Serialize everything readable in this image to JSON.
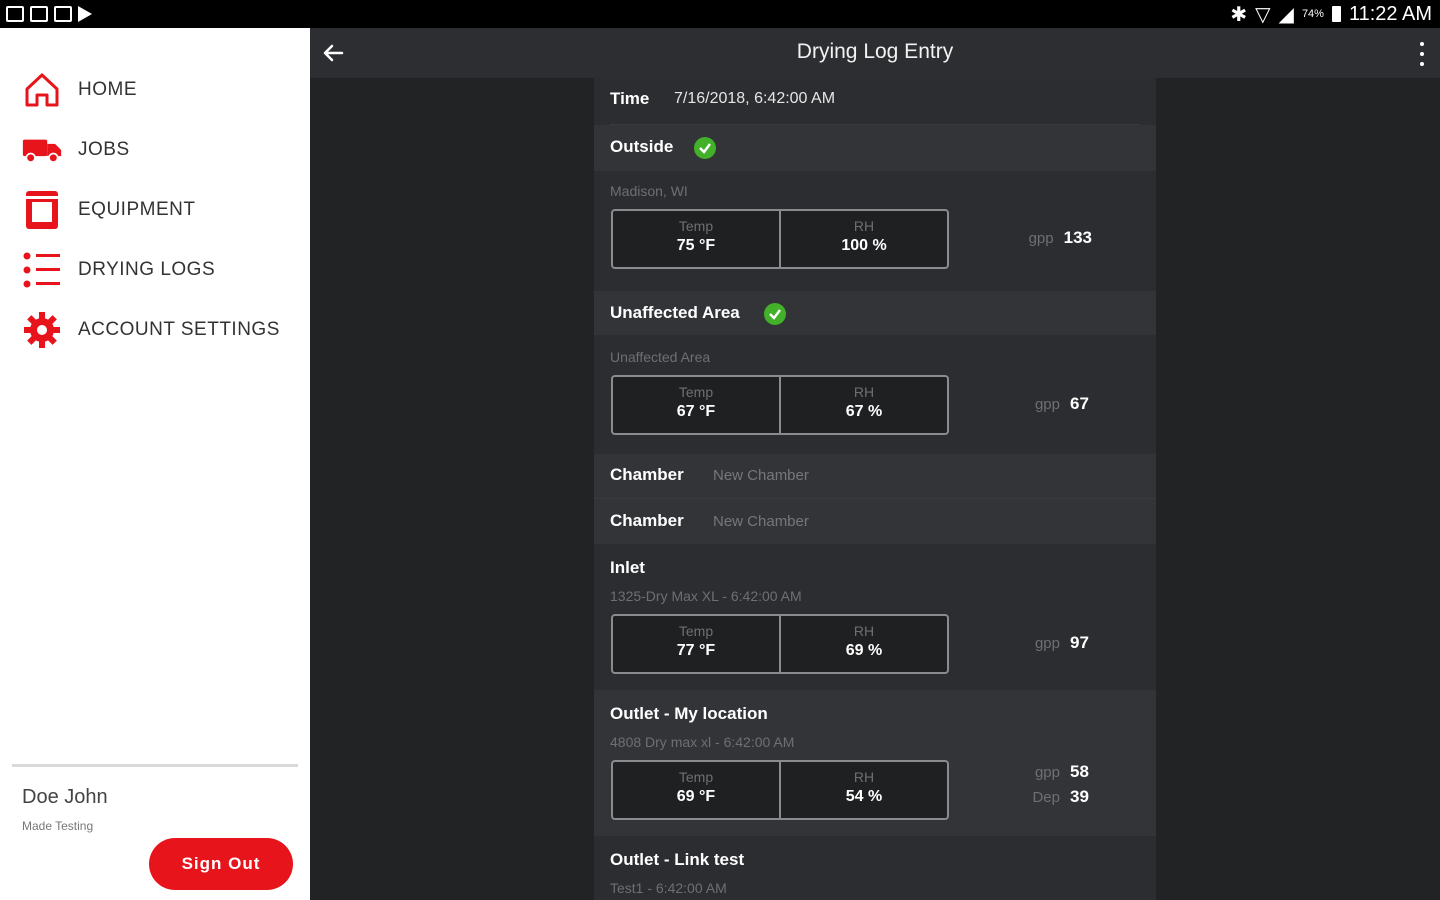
{
  "statusbar": {
    "battery": "74%",
    "time": "11:22 AM"
  },
  "sidebar": {
    "items": [
      {
        "label": "HOME"
      },
      {
        "label": "JOBS"
      },
      {
        "label": "EQUIPMENT"
      },
      {
        "label": "DRYING LOGS"
      },
      {
        "label": "ACCOUNT SETTINGS"
      }
    ],
    "user_name": "Doe John",
    "user_company": "Made Testing",
    "signout_label": "Sign Out"
  },
  "toolbar": {
    "title": "Drying Log Entry"
  },
  "log": {
    "time_label": "Time",
    "time_value": "7/16/2018, 6:42:00 AM",
    "outside": {
      "label": "Outside",
      "location": "Madison, WI",
      "temp_label": "Temp",
      "temp": "75 °F",
      "rh_label": "RH",
      "rh": "100 %",
      "gpp_label": "gpp",
      "gpp": "133"
    },
    "unaffected": {
      "label": "Unaffected Area",
      "location": "Unaffected Area",
      "temp_label": "Temp",
      "temp": "67 °F",
      "rh_label": "RH",
      "rh": "67 %",
      "gpp_label": "gpp",
      "gpp": "67"
    },
    "chambers": [
      {
        "label": "Chamber",
        "value": "New Chamber"
      },
      {
        "label": "Chamber",
        "value": "New Chamber"
      }
    ],
    "inlet": {
      "label": "Inlet",
      "device": "1325-Dry Max XL - 6:42:00 AM",
      "temp_label": "Temp",
      "temp": "77 °F",
      "rh_label": "RH",
      "rh": "69 %",
      "gpp_label": "gpp",
      "gpp": "97"
    },
    "outlet1": {
      "label": "Outlet - My location",
      "device": "4808 Dry max xl - 6:42:00 AM",
      "temp_label": "Temp",
      "temp": "69 °F",
      "rh_label": "RH",
      "rh": "54 %",
      "gpp_label": "gpp",
      "gpp": "58",
      "dep_label": "Dep",
      "dep": "39"
    },
    "outlet2": {
      "label": "Outlet - Link test",
      "device": "Test1 - 6:42:00 AM"
    }
  },
  "colors": {
    "accent": "#e8141c",
    "check": "#43b02a",
    "panel": "#2c2d30",
    "background": "#222325"
  }
}
